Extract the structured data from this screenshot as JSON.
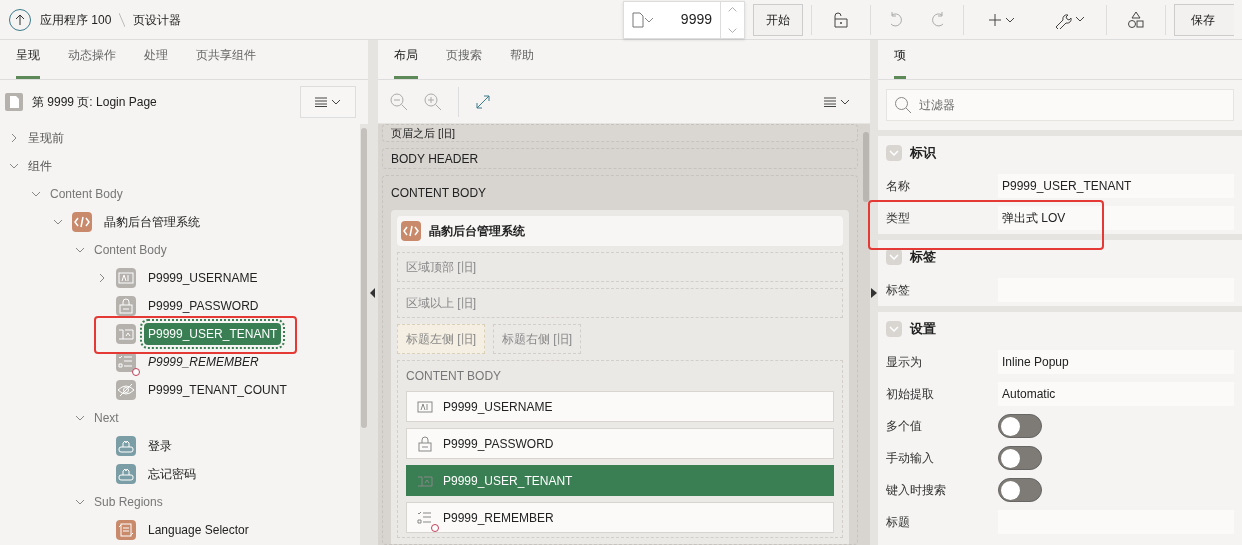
{
  "breadcrumb": {
    "app": "应用程序 100",
    "page": "页设计器"
  },
  "toolbar": {
    "page_number": "9999",
    "go_button": "开始",
    "save_button": "保存"
  },
  "left_panel": {
    "tabs": [
      {
        "label": "呈现",
        "selected": true
      },
      {
        "label": "动态操作",
        "selected": false
      },
      {
        "label": "处理",
        "selected": false
      },
      {
        "label": "页共享组件",
        "selected": false
      }
    ],
    "page_title": "第 9999 页: Login Page",
    "tree": [
      {
        "label": "呈现前",
        "kind": "folder",
        "expanded": false,
        "selected": false
      },
      {
        "label": "组件",
        "kind": "folder",
        "expanded": true,
        "selected": false,
        "children": [
          {
            "label": "Content Body",
            "kind": "group",
            "expanded": true,
            "selected": false,
            "children": [
              {
                "label": "晶豹后台管理系统",
                "kind": "code-region",
                "expanded": true,
                "selected": false,
                "children": [
                  {
                    "label": "Content Body",
                    "kind": "group",
                    "expanded": true,
                    "selected": false,
                    "children": [
                      {
                        "label": "P9999_USERNAME",
                        "kind": "text-field",
                        "expanded": false,
                        "selected": false
                      },
                      {
                        "label": "P9999_PASSWORD",
                        "kind": "password",
                        "selected": false
                      },
                      {
                        "label": "P9999_USER_TENANT",
                        "kind": "popup-lov",
                        "selected": true
                      },
                      {
                        "label": "P9999_REMEMBER",
                        "kind": "checkbox",
                        "selected": false,
                        "conditional": true
                      },
                      {
                        "label": "P9999_TENANT_COUNT",
                        "kind": "hidden",
                        "selected": false
                      }
                    ]
                  },
                  {
                    "label": "Next",
                    "kind": "group",
                    "expanded": true,
                    "selected": false,
                    "children": [
                      {
                        "label": "登录",
                        "kind": "button",
                        "selected": false
                      },
                      {
                        "label": "忘记密码",
                        "kind": "button",
                        "selected": false
                      }
                    ]
                  },
                  {
                    "label": "Sub Regions",
                    "kind": "group",
                    "expanded": true,
                    "selected": false,
                    "children": [
                      {
                        "label": "Language Selector",
                        "kind": "list-region",
                        "selected": false
                      }
                    ]
                  }
                ]
              }
            ]
          }
        ]
      }
    ]
  },
  "layout_panel": {
    "tabs": [
      {
        "label": "布局",
        "selected": true
      },
      {
        "label": "页搜索",
        "selected": false
      },
      {
        "label": "帮助",
        "selected": false
      }
    ],
    "top_slot": "页眉之后 [旧]",
    "body_header": "BODY HEADER",
    "content_body": "CONTENT BODY",
    "region": {
      "title": "晶豹后台管理系统",
      "slots": [
        "区域顶部 [旧]",
        "区域以上 [旧]"
      ],
      "title_slots": [
        {
          "label": "标题左侧 [旧]",
          "selected": true
        },
        {
          "label": "标题右侧 [旧]",
          "selected": false
        }
      ],
      "body_label": "CONTENT BODY",
      "items": [
        {
          "label": "P9999_USERNAME",
          "kind": "text-field",
          "selected": false
        },
        {
          "label": "P9999_PASSWORD",
          "kind": "password",
          "selected": false
        },
        {
          "label": "P9999_USER_TENANT",
          "kind": "popup-lov",
          "selected": true
        },
        {
          "label": "P9999_REMEMBER",
          "kind": "checkbox",
          "selected": false,
          "conditional": true
        }
      ]
    }
  },
  "property_panel": {
    "tabs": [
      {
        "label": "项",
        "selected": true
      }
    ],
    "filter_placeholder": "过滤器",
    "sections": [
      {
        "title": "标识",
        "expanded": true,
        "rows": [
          {
            "label": "名称",
            "kind": "text",
            "value": "P9999_USER_TENANT"
          },
          {
            "label": "类型",
            "kind": "text",
            "value": "弹出式 LOV"
          }
        ]
      },
      {
        "title": "标签",
        "expanded": true,
        "rows": [
          {
            "label": "标签",
            "kind": "text"
          }
        ]
      },
      {
        "title": "设置",
        "expanded": true,
        "rows": [
          {
            "label": "显示为",
            "kind": "text",
            "value": "Inline Popup"
          },
          {
            "label": "初始提取",
            "kind": "text",
            "value": "Automatic"
          },
          {
            "label": "多个值",
            "kind": "switch",
            "on": false
          },
          {
            "label": "手动输入",
            "kind": "switch",
            "on": false
          },
          {
            "label": "键入时搜索",
            "kind": "switch",
            "on": false
          },
          {
            "label": "标题",
            "kind": "text"
          }
        ]
      }
    ]
  }
}
